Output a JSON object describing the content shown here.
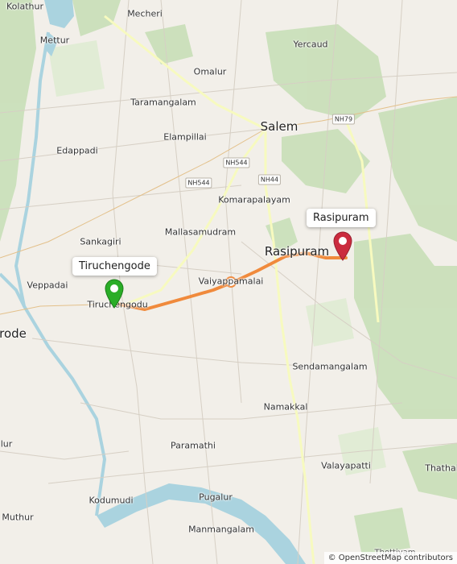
{
  "map": {
    "places": [
      {
        "id": "kolathur",
        "name": "Kolathur",
        "kind": "town"
      },
      {
        "id": "mecheri",
        "name": "Mecheri",
        "kind": "town"
      },
      {
        "id": "mettur",
        "name": "Mettur",
        "kind": "town"
      },
      {
        "id": "yercaud",
        "name": "Yercaud",
        "kind": "town"
      },
      {
        "id": "omalur",
        "name": "Omalur",
        "kind": "town"
      },
      {
        "id": "taramangalam",
        "name": "Taramangalam",
        "kind": "town"
      },
      {
        "id": "salem",
        "name": "Salem",
        "kind": "city"
      },
      {
        "id": "elampillai",
        "name": "Elampillai",
        "kind": "town"
      },
      {
        "id": "edappadi",
        "name": "Edappadi",
        "kind": "town"
      },
      {
        "id": "komarapalayam",
        "name": "Komarapalayam",
        "kind": "town"
      },
      {
        "id": "mallasamudram",
        "name": "Mallasamudram",
        "kind": "town"
      },
      {
        "id": "sankagiri",
        "name": "Sankagiri",
        "kind": "town"
      },
      {
        "id": "rasipuram_city",
        "name": "Rasipuram",
        "kind": "city"
      },
      {
        "id": "veppadai",
        "name": "Veppadai",
        "kind": "town"
      },
      {
        "id": "vaiyappamalai",
        "name": "Vaiyappamalai",
        "kind": "town"
      },
      {
        "id": "tiruchengodu",
        "name": "Tiruchengodu",
        "kind": "town"
      },
      {
        "id": "erode",
        "name": "rode",
        "kind": "city"
      },
      {
        "id": "sendamangalam",
        "name": "Sendamangalam",
        "kind": "town"
      },
      {
        "id": "namakkal",
        "name": "Namakkal",
        "kind": "town"
      },
      {
        "id": "lur",
        "name": "lur",
        "kind": "town"
      },
      {
        "id": "paramathi",
        "name": "Paramathi",
        "kind": "town"
      },
      {
        "id": "valayapatti",
        "name": "Valayapatti",
        "kind": "town"
      },
      {
        "id": "thathaiyangarpet",
        "name": "Thathai",
        "kind": "town"
      },
      {
        "id": "pugalur",
        "name": "Pugalur",
        "kind": "town"
      },
      {
        "id": "kodumudi",
        "name": "Kodumudi",
        "kind": "town"
      },
      {
        "id": "muthur",
        "name": "Muthur",
        "kind": "town"
      },
      {
        "id": "manmangalam",
        "name": "Manmangalam",
        "kind": "town"
      },
      {
        "id": "thottiyam",
        "name": "Thottiyam",
        "kind": "small"
      }
    ],
    "road_shields": [
      {
        "id": "nh79",
        "label": "NH79"
      },
      {
        "id": "nh544a",
        "label": "NH544"
      },
      {
        "id": "nh544b",
        "label": "NH544"
      },
      {
        "id": "nh44",
        "label": "NH44"
      }
    ],
    "route": {
      "start_label": "Tiruchengode",
      "end_label": "Rasipuram",
      "start_color": "#2aad27",
      "end_color": "#cb2b3e",
      "route_color": "#f08a3c"
    },
    "attribution": "© OpenStreetMap contributors"
  }
}
